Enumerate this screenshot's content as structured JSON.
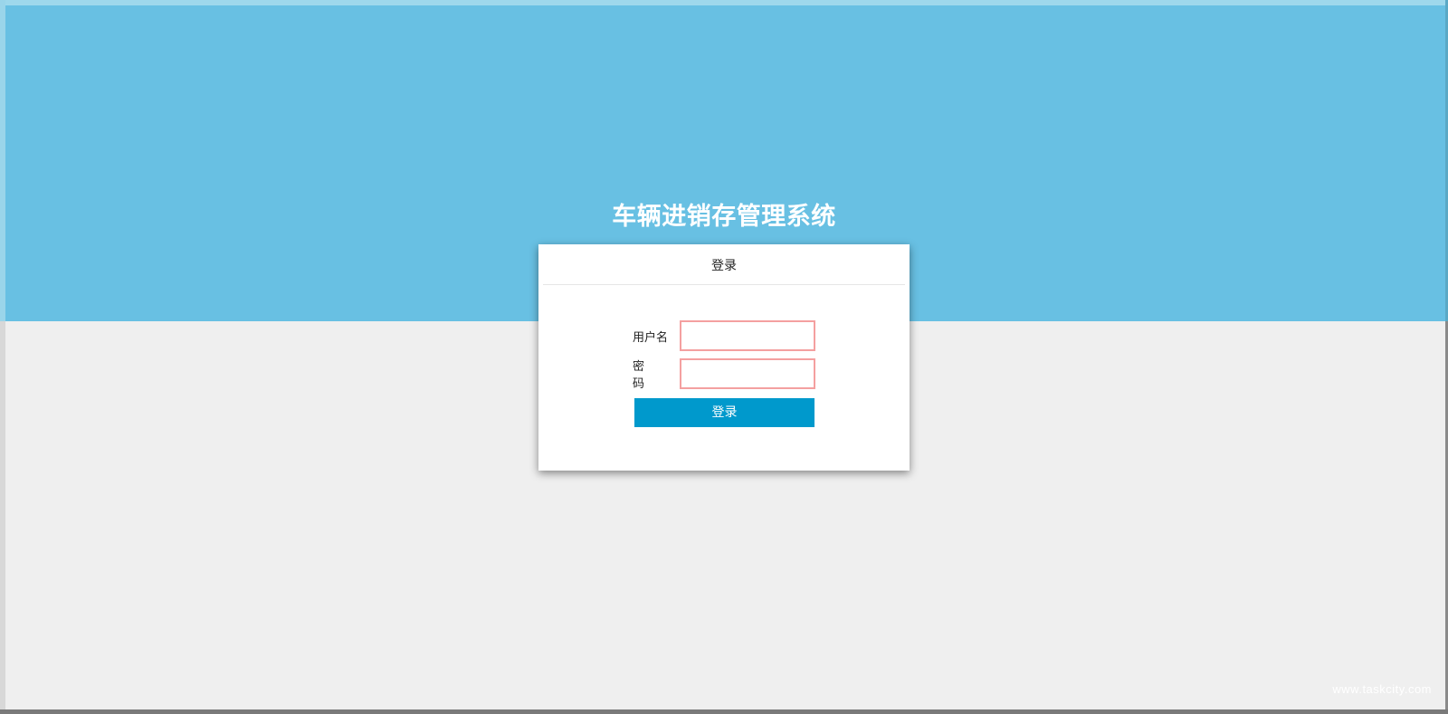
{
  "app": {
    "title": "车辆进销存管理系统"
  },
  "login": {
    "header": "登录",
    "username_label": "用户名",
    "username_value": "",
    "password_label": "密码",
    "password_value": "",
    "submit_label": "登录"
  },
  "footer": {
    "watermark": "www.taskcity.com"
  },
  "colors": {
    "banner": "#68c0e3",
    "background": "#efefef",
    "button": "#0099cc"
  }
}
